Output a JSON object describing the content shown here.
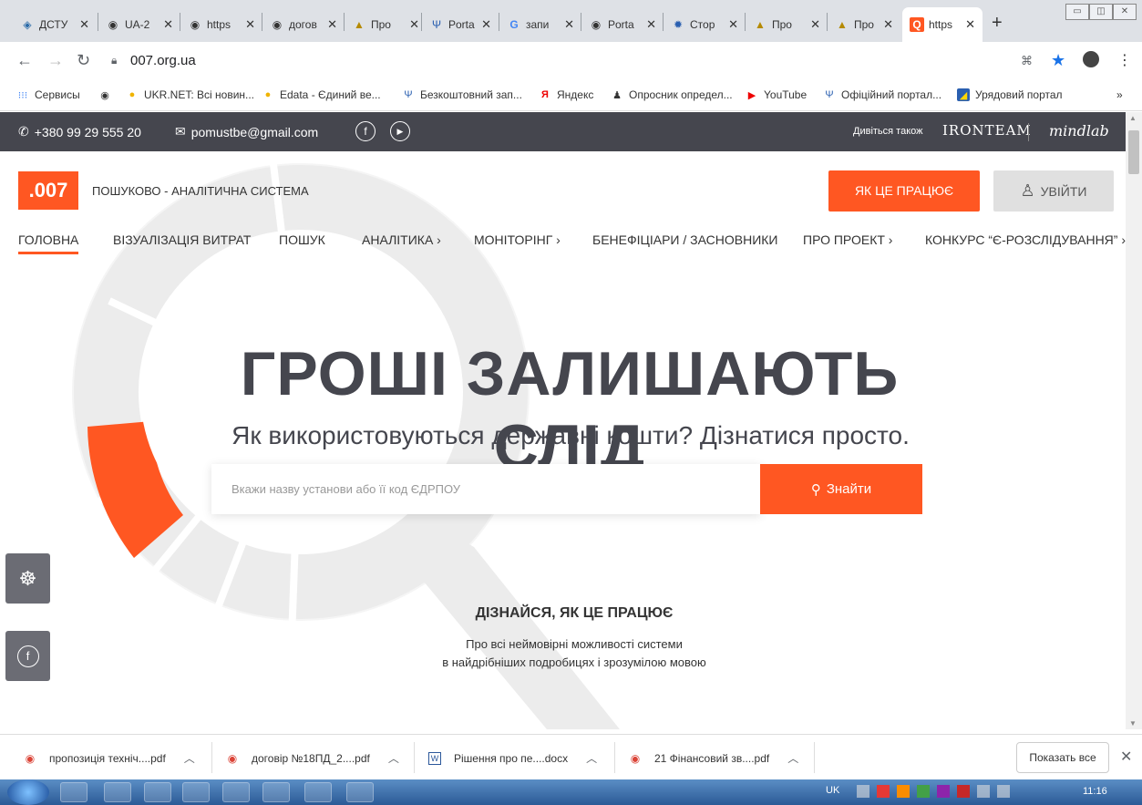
{
  "browser": {
    "tabs": [
      {
        "title": "ДСТУ",
        "icon": "diamond-icon"
      },
      {
        "title": "UA-2",
        "icon": "globe-icon"
      },
      {
        "title": "https",
        "icon": "globe-icon"
      },
      {
        "title": "догов",
        "icon": "globe-icon"
      },
      {
        "title": "Про",
        "icon": "building-icon"
      },
      {
        "title": "Porta",
        "icon": "trident-icon"
      },
      {
        "title": "запи",
        "icon": "google-icon"
      },
      {
        "title": "Porta",
        "icon": "globe-icon"
      },
      {
        "title": "Стор",
        "icon": "emblem-icon"
      },
      {
        "title": "Про",
        "icon": "building-icon"
      },
      {
        "title": "Про",
        "icon": "building-icon"
      },
      {
        "title": "https",
        "icon": "q-icon",
        "active": true
      }
    ],
    "url": "007.org.ua",
    "bookmarks": [
      {
        "label": "Сервисы",
        "icon": "apps-icon"
      },
      {
        "label": "",
        "icon": "globe-icon"
      },
      {
        "label": "UKR.NET: Всі новин...",
        "icon": "ukrnet-icon"
      },
      {
        "label": "Edata - Єдиний ве...",
        "icon": "edata-icon"
      },
      {
        "label": "Безкоштовний зап...",
        "icon": "trident-icon"
      },
      {
        "label": "Яндекс",
        "icon": "yandex-icon"
      },
      {
        "label": "Опросник определ...",
        "icon": "person-icon"
      },
      {
        "label": "YouTube",
        "icon": "youtube-icon"
      },
      {
        "label": "Офіційний портал...",
        "icon": "trident-icon"
      },
      {
        "label": "Урядовий портал",
        "icon": "gov-icon"
      }
    ]
  },
  "site": {
    "phone": "+380 99 29 555 20",
    "email": "pomustbe@gmail.com",
    "see_also": "Дивіться також",
    "partner1": "IRONTEAM",
    "partner2": "mindlab",
    "logo": ".007",
    "tagline": "ПОШУКОВО - АНАЛІТИЧНА СИСТЕМА",
    "how_button": "ЯК ЦЕ ПРАЦЮЄ",
    "login_button": "УВІЙТИ",
    "menu": [
      "ГОЛОВНА",
      "ВІЗУАЛІЗАЦІЯ ВИТРАТ",
      "ПОШУК",
      "АНАЛІТИКА ›",
      "МОНІТОРІНГ ›",
      "БЕНЕФІЦІАРИ / ЗАСНОВНИКИ",
      "ПРО ПРОЕКТ ›",
      "КОНКУРС “Є-РОЗСЛІДУВАННЯ” ›"
    ],
    "hero_title": "ГРОШІ ЗАЛИШАЮТЬ СЛІД",
    "hero_subtitle": "Як використовуються державні кошти? Дізнатися просто.",
    "search_placeholder": "Вкажи назву установи або її код ЄДРПОУ",
    "search_button": "Знайти",
    "learn_title": "ДІЗНАЙСЯ, ЯК ЦЕ ПРАЦЮЄ",
    "learn_line1": "Про всі неймовірні можливості системи",
    "learn_line2": "в найдрібніших подробицях і зрозумілою мовою",
    "accent": "#ff5722"
  },
  "downloads": {
    "items": [
      {
        "name": "пропозиція техніч....pdf",
        "icon": "chrome-icon"
      },
      {
        "name": "договір №18ПД_2....pdf",
        "icon": "chrome-icon"
      },
      {
        "name": "Рішення про пе....docx",
        "icon": "word-icon"
      },
      {
        "name": "21 Фінансовий зв....pdf",
        "icon": "chrome-icon"
      }
    ],
    "show_all": "Показать все"
  },
  "taskbar": {
    "lang": "UK",
    "time": "11:16"
  }
}
